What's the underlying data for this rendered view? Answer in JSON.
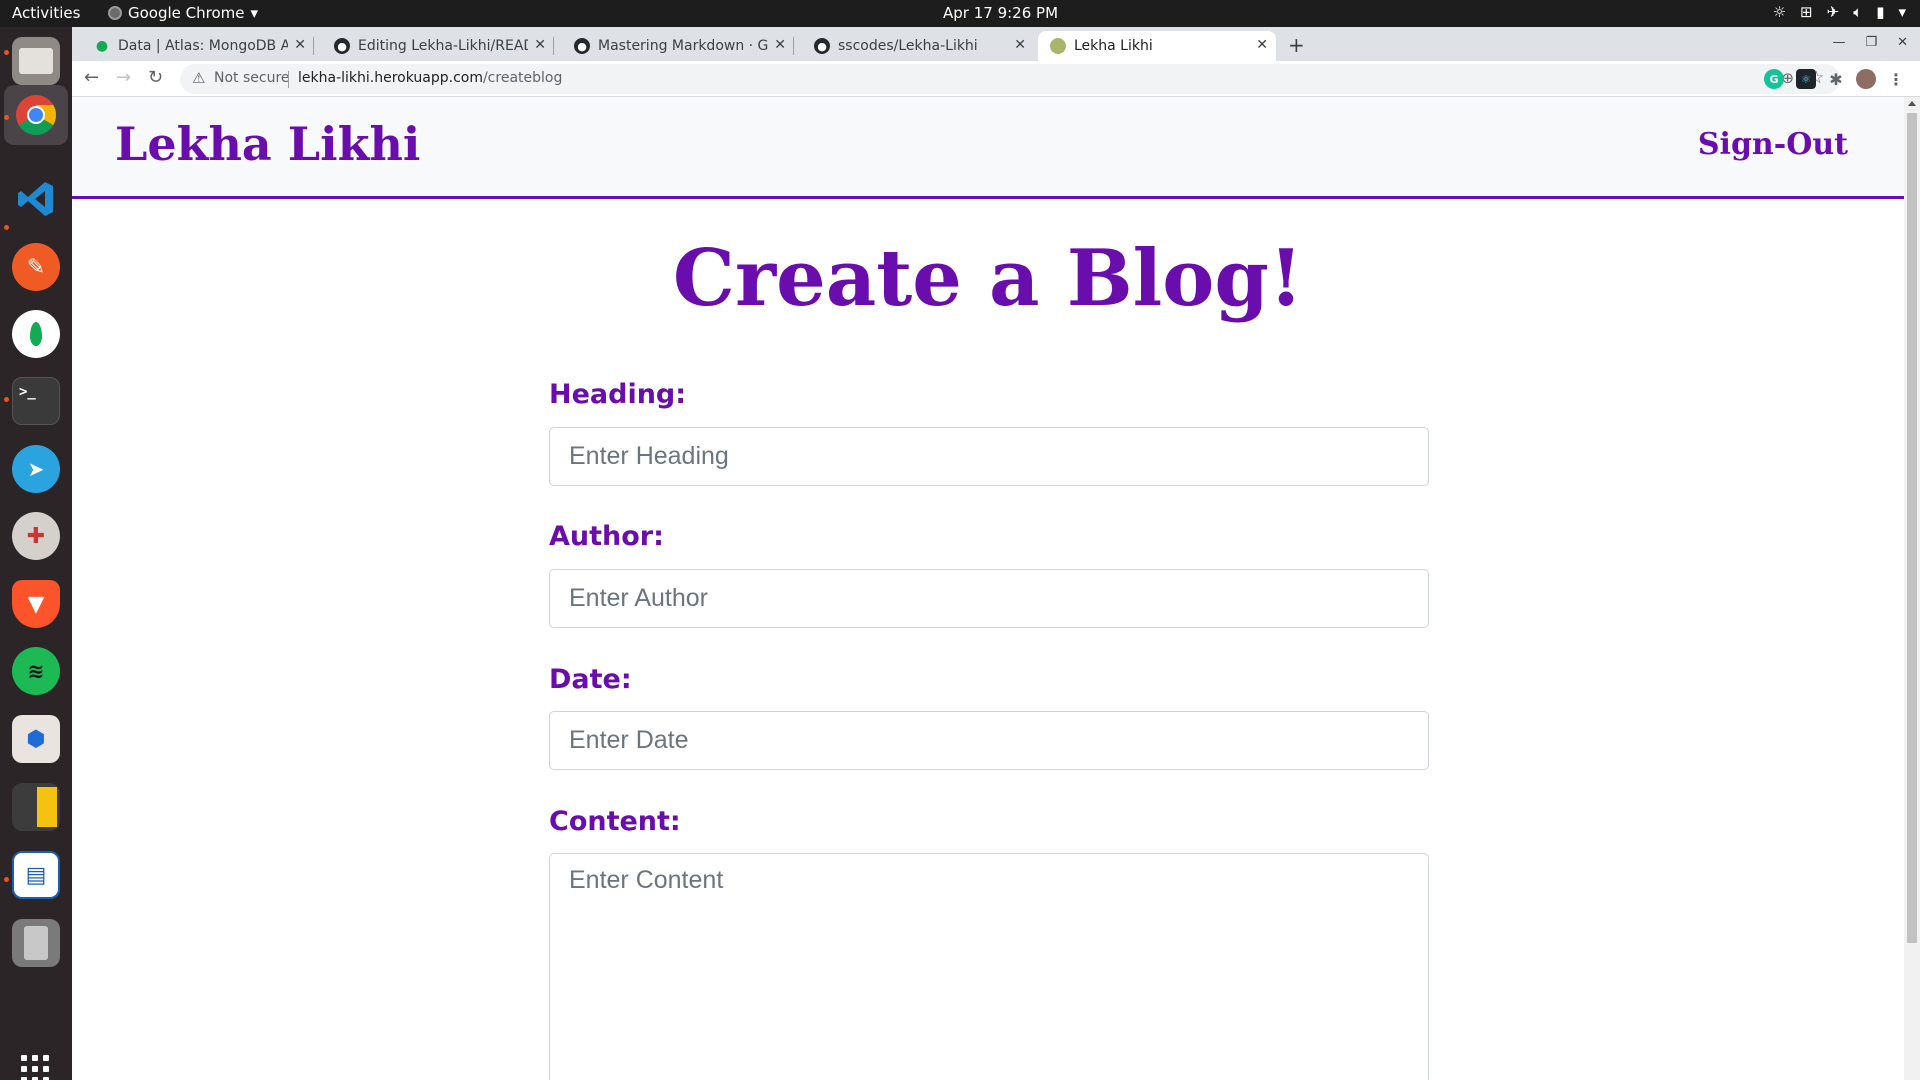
{
  "system": {
    "activities": "Activities",
    "app_menu": "Google Chrome",
    "clock": "Apr 17  9:26 PM"
  },
  "dock": {
    "apps": [
      "files-icon",
      "chrome-icon",
      "vscode-icon",
      "postman-icon",
      "mongodb-compass-icon",
      "terminal-icon",
      "telegram-icon",
      "disk-icon",
      "brave-icon",
      "spotify-icon",
      "software-store-icon",
      "calculator-icon",
      "writer-icon",
      "trash-icon"
    ]
  },
  "browser": {
    "tabs": [
      {
        "title": "Data | Atlas: MongoDB Atlas",
        "icon": "mongodb-leaf-icon"
      },
      {
        "title": "Editing Lekha-Likhi/README.md",
        "icon": "github-icon"
      },
      {
        "title": "Mastering Markdown · GitHub Guides",
        "icon": "github-icon"
      },
      {
        "title": "sscodes/Lekha-Likhi",
        "icon": "github-icon"
      },
      {
        "title": "Lekha Likhi",
        "icon": "site-favicon"
      }
    ],
    "security_label": "Not secure",
    "url_host": "lekha-likhi.herokuapp.com",
    "url_path": "/createblog"
  },
  "site": {
    "brand": "Lekha Likhi",
    "signout": "Sign-Out",
    "page_title": "Create a Blog!",
    "accent_color": "#6a0dad"
  },
  "form": {
    "heading_label": "Heading:",
    "heading_placeholder": "Enter Heading",
    "author_label": "Author:",
    "author_placeholder": "Enter Author",
    "date_label": "Date:",
    "date_placeholder": "Enter Date",
    "content_label": "Content:",
    "content_placeholder": "Enter Content"
  }
}
